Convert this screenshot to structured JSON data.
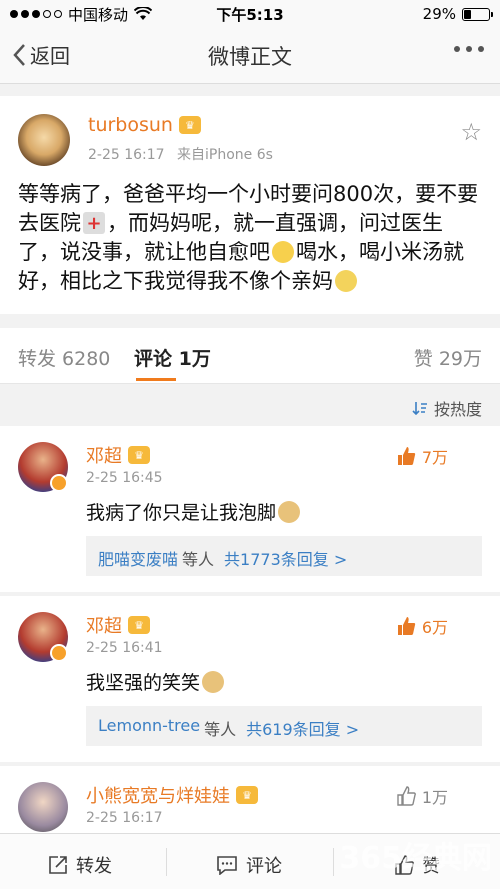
{
  "status": {
    "carrier": "中国移动",
    "time": "下午5:13",
    "battery": "29%",
    "battery_level": 0.29
  },
  "nav": {
    "back_label": "返回",
    "title": "微博正文"
  },
  "post": {
    "username": "turbosun",
    "time": "2-25 16:17",
    "source": "来自iPhone 6s",
    "text_1": "等等病了，爸爸平均一个小时要问800次，要不要去医院",
    "text_2": "，而妈妈呢，就一直强调，问过医生了，说没事，就让他自愈吧",
    "text_3": "喝水，喝小米汤就好，相比之下我觉得我不像个亲妈"
  },
  "tabs": {
    "repost": "转发 6280",
    "comments": "评论 1万",
    "likes": "赞 29万"
  },
  "sort": {
    "label": "按热度"
  },
  "comments": [
    {
      "name": "邓超",
      "time": "2-25 16:45",
      "text": "我病了你只是让我泡脚",
      "likes": "7万",
      "reply_users": "肥喵变废喵",
      "reply_mid": "等人",
      "reply_count": "共1773条回复 >"
    },
    {
      "name": "邓超",
      "time": "2-25 16:41",
      "text": "我坚强的笑笑",
      "likes": "6万",
      "reply_users": "Lemonn-tree",
      "reply_mid": "等人",
      "reply_count": "共619条回复 >"
    },
    {
      "name": "小熊宽宽与烊娃娃",
      "time": "2-25 16:17",
      "likes": "1万"
    }
  ],
  "bottom": {
    "repost": "转发",
    "comment": "评论",
    "like": "赞"
  },
  "watermark": "365经典网"
}
